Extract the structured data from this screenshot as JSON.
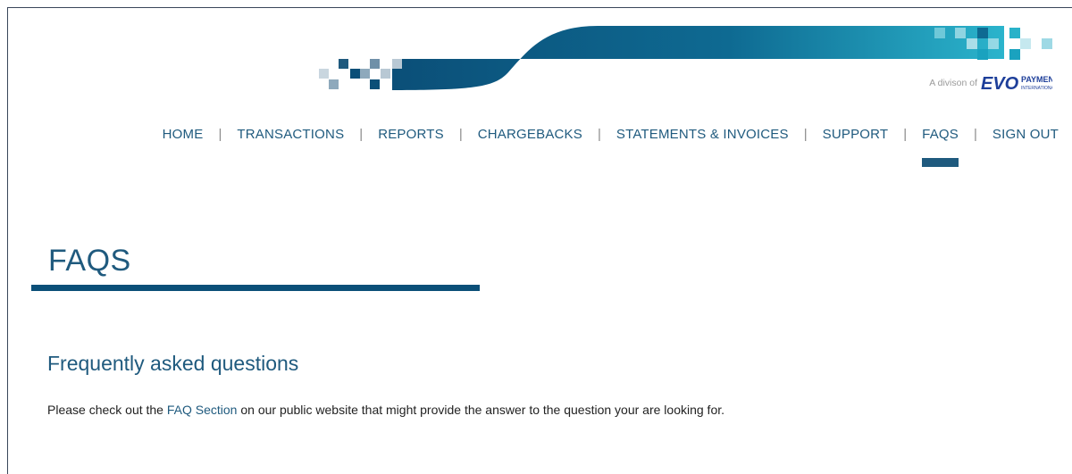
{
  "header": {
    "division_text": "A divison of",
    "logo_mark": "EVO",
    "logo_text_top": "PAYMENTS",
    "logo_text_bottom": "INTERNATIONAL"
  },
  "nav": {
    "items": [
      {
        "label": "HOME"
      },
      {
        "label": "TRANSACTIONS"
      },
      {
        "label": "REPORTS"
      },
      {
        "label": "CHARGEBACKS"
      },
      {
        "label": "STATEMENTS & INVOICES"
      },
      {
        "label": "SUPPORT"
      },
      {
        "label": "FAQS",
        "active": true
      },
      {
        "label": "SIGN OUT"
      }
    ],
    "separator": "|"
  },
  "main": {
    "title": "FAQS",
    "heading": "Frequently asked questions",
    "text_before": "Please check out the ",
    "link_text": "FAQ Section",
    "text_after": " on our public website that might provide the answer to the question your are looking for."
  },
  "colors": {
    "brand_dark": "#0b4f78",
    "brand_teal": "#29b2c9",
    "nav_text": "#1f5a7e"
  }
}
